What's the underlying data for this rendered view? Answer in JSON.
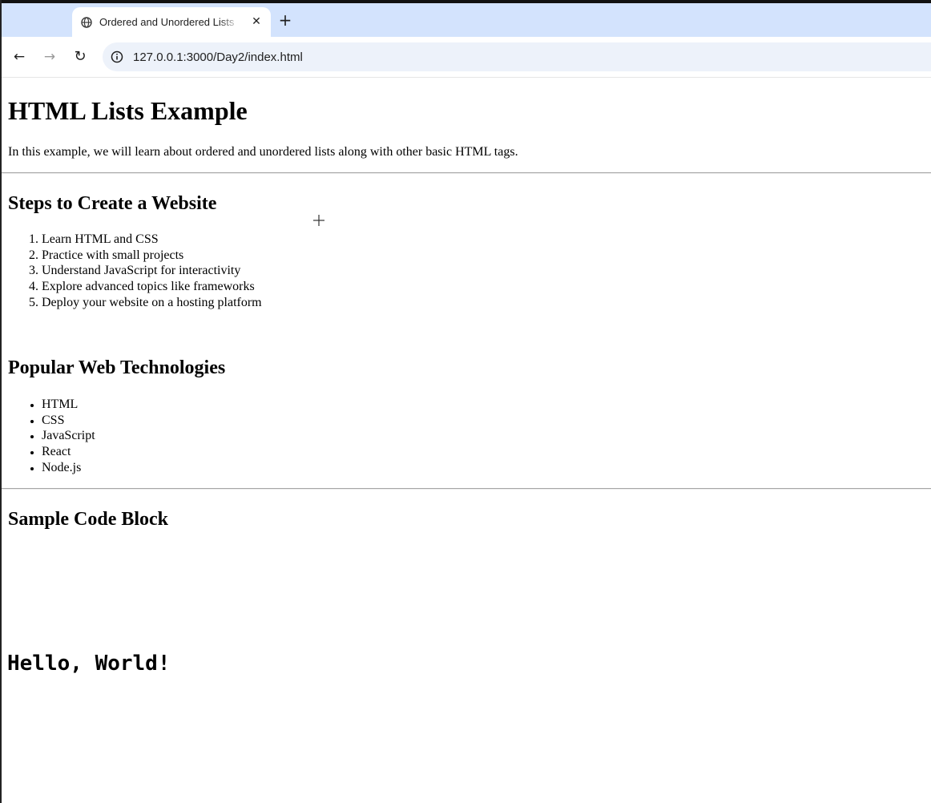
{
  "browser": {
    "tab": {
      "title": "Ordered and Unordered Lists",
      "favicon": "globe-icon",
      "close_glyph": "✕"
    },
    "new_tab_glyph": "+",
    "nav": {
      "back_glyph": "←",
      "forward_glyph": "→",
      "reload_glyph": "↻"
    },
    "address": {
      "url": "127.0.0.1:3000/Day2/index.html",
      "icon": "info-icon"
    }
  },
  "page": {
    "title": "HTML Lists Example",
    "intro": "In this example, we will learn about ordered and unordered lists along with other basic HTML tags.",
    "steps": {
      "heading": "Steps to Create a Website",
      "items": [
        "Learn HTML and CSS",
        "Practice with small projects",
        "Understand JavaScript for interactivity",
        "Explore advanced topics like frameworks",
        "Deploy your website on a hosting platform"
      ]
    },
    "technologies": {
      "heading": "Popular Web Technologies",
      "items": [
        "HTML",
        "CSS",
        "JavaScript",
        "React",
        "Node.js"
      ]
    },
    "code": {
      "heading": "Sample Code Block",
      "text": "Hello, World!"
    }
  },
  "colors": {
    "tabstrip": "#d3e3fd",
    "omnibox": "#edf2fa",
    "text": "#000000"
  }
}
